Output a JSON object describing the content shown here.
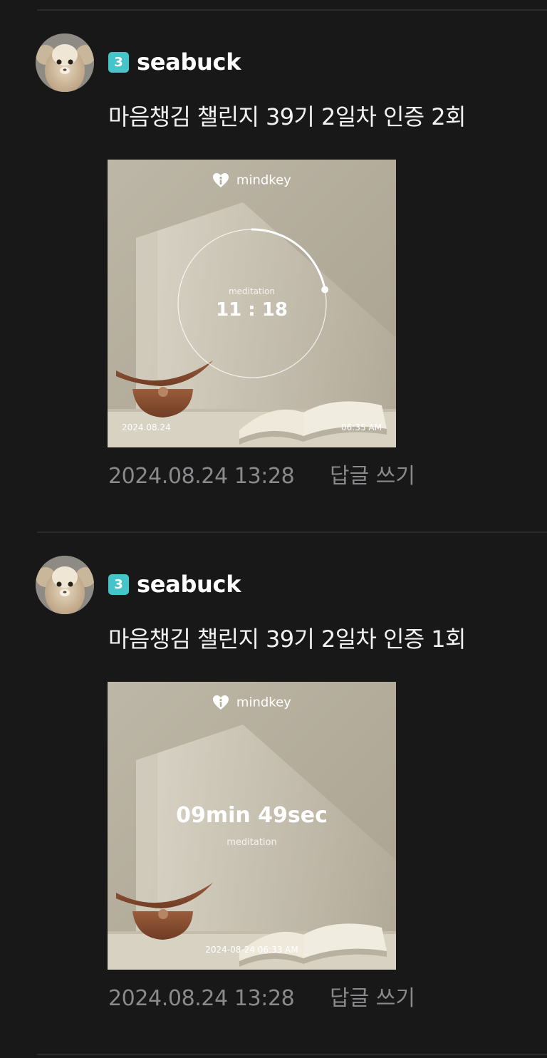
{
  "comments": [
    {
      "level": "3",
      "username": "seabuck",
      "text": "마음챙김 챌린지 39기 2일차 인증 2회",
      "photo": {
        "brand": "mindkey",
        "label": "meditation",
        "time": "11 : 18",
        "progress": 0.22,
        "date_left": "2024.08.24",
        "time_right": "06:35 AM"
      },
      "timestamp": "2024.08.24 13:28",
      "reply_label": "답글 쓰기"
    },
    {
      "level": "3",
      "username": "seabuck",
      "text": "마음챙김 챌린지 39기 2일차 인증 1회",
      "photo": {
        "brand": "mindkey",
        "duration": "09min 49sec",
        "label": "meditation",
        "datetime": "2024-08-24 06:33 AM"
      },
      "timestamp": "2024.08.24 13:28",
      "reply_label": "답글 쓰기"
    }
  ],
  "colors": {
    "background": "#181819",
    "badge": "#45c5c9",
    "muted_text": "#8a8a8c",
    "photo_tone": "#b4ad9c"
  },
  "icons": {
    "brand_logo": "heart-i-icon"
  }
}
